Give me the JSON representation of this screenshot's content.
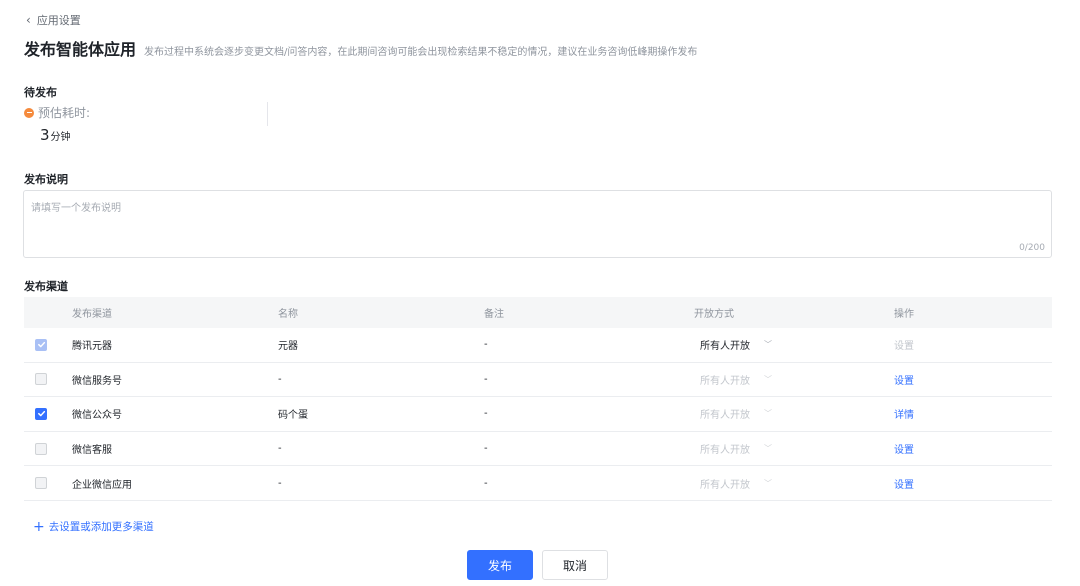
{
  "breadcrumb": {
    "back_label": "应用设置"
  },
  "header": {
    "title": "发布智能体应用",
    "subtitle": "发布过程中系统会逐步变更文档/问答内容，在此期间咨询可能会出现检索结果不稳定的情况，建议在业务咨询低峰期操作发布"
  },
  "pending": {
    "label": "待发布",
    "estimate_label": "预估耗时:",
    "estimate_value": "3",
    "estimate_unit": "分钟"
  },
  "description": {
    "label": "发布说明",
    "placeholder": "请填写一个发布说明",
    "value": "",
    "counter": "0/200"
  },
  "channels": {
    "label": "发布渠道",
    "columns": [
      "发布渠道",
      "名称",
      "备注",
      "开放方式",
      "操作"
    ],
    "rows": [
      {
        "checked": true,
        "disabled": true,
        "channel": "腾讯元器",
        "name": "元器",
        "note": "-",
        "mode": "所有人开放",
        "mode_enabled": true,
        "action": "设置",
        "action_enabled": false
      },
      {
        "checked": false,
        "disabled": true,
        "channel": "微信服务号",
        "name": "-",
        "note": "-",
        "mode": "所有人开放",
        "mode_enabled": false,
        "action": "设置",
        "action_enabled": true
      },
      {
        "checked": true,
        "disabled": false,
        "channel": "微信公众号",
        "name": "码个蛋",
        "note": "-",
        "mode": "所有人开放",
        "mode_enabled": false,
        "action": "详情",
        "action_enabled": true
      },
      {
        "checked": false,
        "disabled": true,
        "channel": "微信客服",
        "name": "-",
        "note": "-",
        "mode": "所有人开放",
        "mode_enabled": false,
        "action": "设置",
        "action_enabled": true
      },
      {
        "checked": false,
        "disabled": true,
        "channel": "企业微信应用",
        "name": "-",
        "note": "-",
        "mode": "所有人开放",
        "mode_enabled": false,
        "action": "设置",
        "action_enabled": true
      }
    ],
    "add_more_label": "去设置或添加更多渠道"
  },
  "actions": {
    "publish_label": "发布",
    "cancel_label": "取消"
  },
  "colors": {
    "primary": "#3370ff",
    "warning_dot": "#f58a3c"
  },
  "icons": {
    "back": "chevron-left-icon",
    "estimate": "minus-circle-icon",
    "dropdown": "chevron-down-icon",
    "add": "plus-icon",
    "check": "check-icon"
  }
}
